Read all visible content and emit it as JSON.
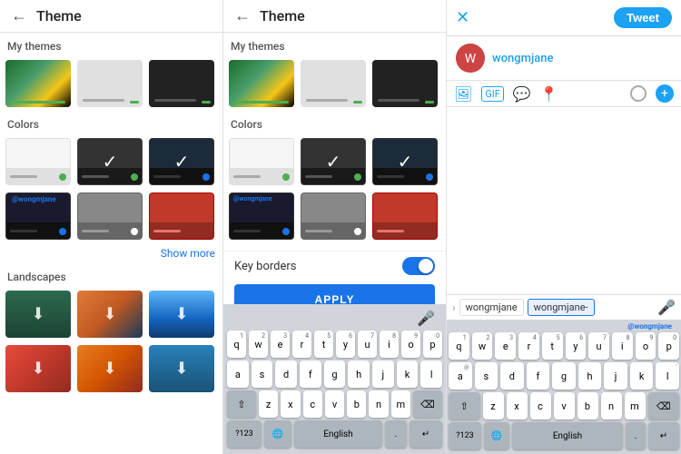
{
  "panel1": {
    "title": "Theme",
    "back_icon": "←",
    "my_themes_label": "My themes",
    "colors_label": "Colors",
    "landscapes_label": "Landscapes",
    "show_more": "Show more",
    "add_theme_hint": "+",
    "color_themes": [
      {
        "id": "white",
        "checked": false,
        "top": "#fff",
        "bottom": "#eee",
        "bar": "#4caf50"
      },
      {
        "id": "dark",
        "checked": true,
        "top": "#222",
        "bottom": "#333",
        "bar": "#4caf50"
      },
      {
        "id": "dark-checked",
        "checked": true,
        "top": "#1a1a2e",
        "bottom": "#111",
        "bar": "#1a73e8"
      }
    ],
    "custom_themes": [
      {
        "id": "custom1",
        "label": "@wongmjane",
        "top": "#1a1a2e",
        "bottom": "#111"
      },
      {
        "id": "custom2",
        "top": "#c0392b",
        "bottom": "#922b21"
      },
      {
        "id": "custom3",
        "top": "#1a6b2a",
        "bottom": "#145a1e"
      }
    ],
    "landscapes": [
      {
        "id": "ls1",
        "gradient": "landscape-gradient-1"
      },
      {
        "id": "ls2",
        "gradient": "landscape-gradient-2"
      },
      {
        "id": "ls3",
        "gradient": "landscape-gradient-3"
      },
      {
        "id": "ls4",
        "gradient": "landscape-gradient-4"
      },
      {
        "id": "ls5",
        "gradient": "landscape-gradient-5"
      },
      {
        "id": "ls6",
        "gradient": "landscape-gradient-6"
      }
    ]
  },
  "panel2": {
    "title": "Theme",
    "back_icon": "←",
    "my_themes_label": "My themes",
    "colors_label": "Colors",
    "wongmjane_label": "@wongmjane",
    "keyboard": {
      "mic_icon": "🎤",
      "rows": [
        [
          "q",
          "w",
          "e",
          "r",
          "t",
          "y",
          "u",
          "i",
          "o",
          "p"
        ],
        [
          "a",
          "s",
          "d",
          "f",
          "g",
          "h",
          "j",
          "k",
          "l"
        ],
        [
          "z",
          "x",
          "c",
          "v",
          "b",
          "n",
          "m"
        ]
      ],
      "numbers_label": "?123",
      "globe_icon": "🌐",
      "language": "English",
      "dot": ".",
      "enter_icon": "↵"
    },
    "key_borders_label": "Key borders",
    "apply_label": "APPLY"
  },
  "panel3": {
    "close_icon": "✕",
    "tweet_label": "Tweet",
    "username": "wongmjane",
    "avatar_color": "#d44",
    "tools": [
      "image",
      "gif",
      "message",
      "location"
    ],
    "input_suggestions": [
      "wongmjane",
      "wongmjane-"
    ],
    "keyboard": {
      "rows": [
        [
          "q",
          "w",
          "e",
          "r",
          "t",
          "y",
          "u",
          "i",
          "o",
          "p"
        ],
        [
          "a",
          "s",
          "d",
          "f",
          "g",
          "h",
          "j",
          "k",
          "l"
        ],
        [
          "z",
          "x",
          "c",
          "v",
          "b",
          "n",
          "m"
        ]
      ],
      "numbers_label": "?123",
      "globe_icon": "🌐",
      "language": "English",
      "dot": ".",
      "enter_icon": "↵",
      "wongmjane_label": "@wongmjane"
    }
  }
}
